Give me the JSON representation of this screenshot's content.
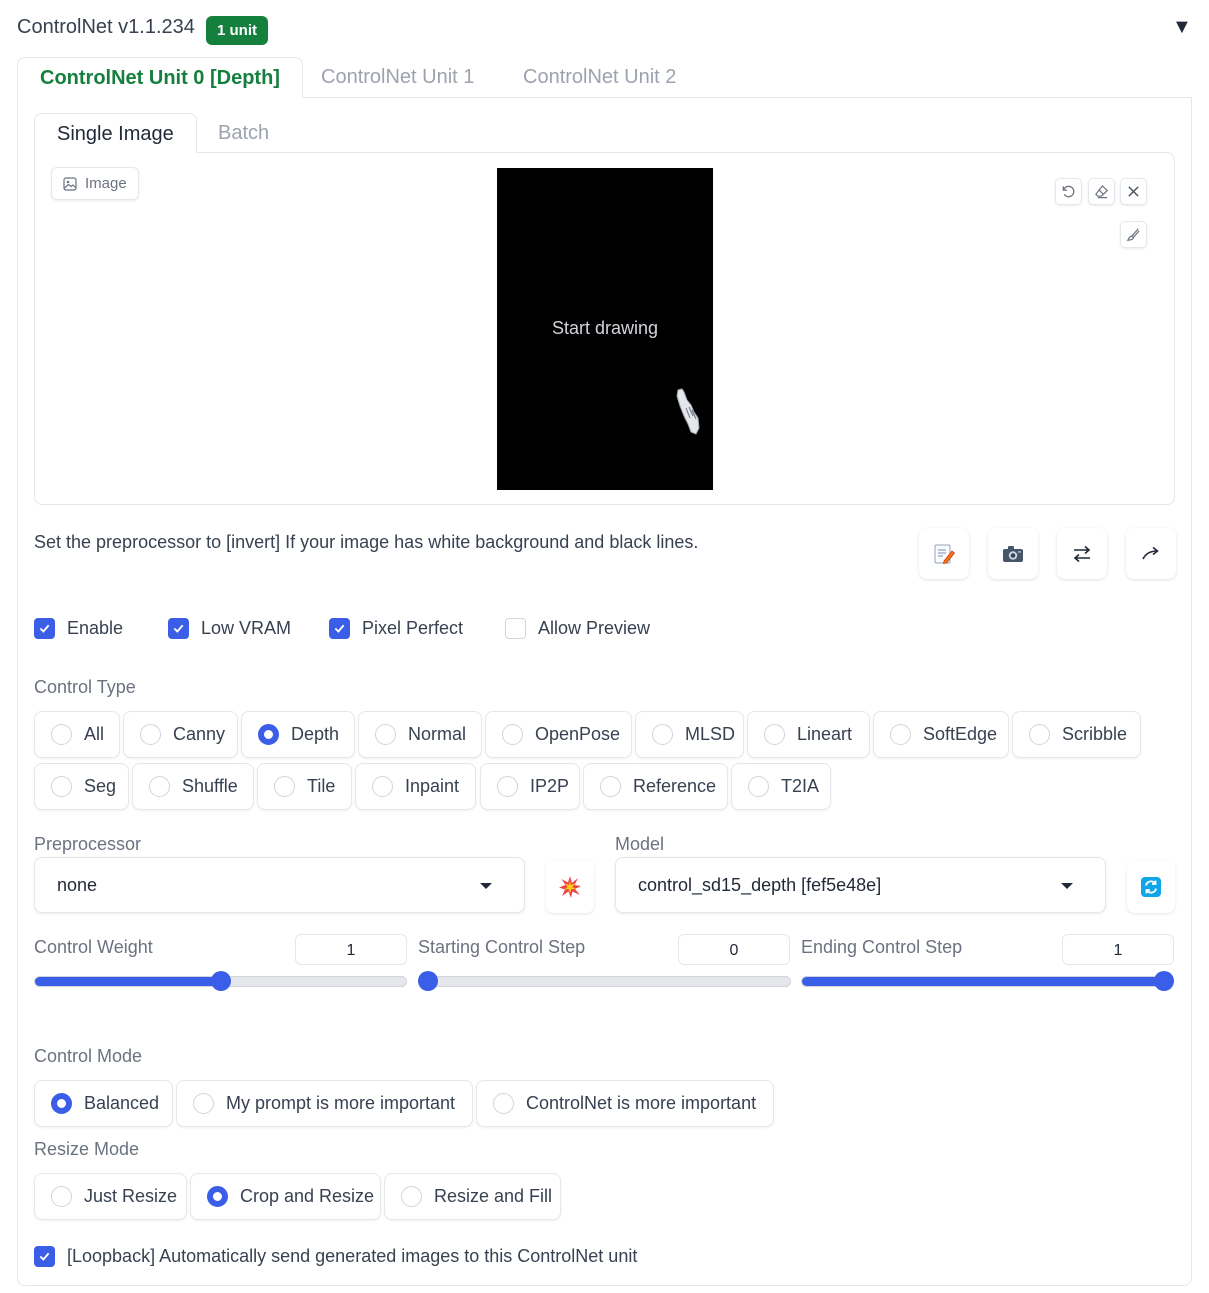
{
  "header": {
    "title": "ControlNet v1.1.234",
    "badge": "1 unit",
    "collapse_icon": "▼"
  },
  "unit_tabs": [
    {
      "label": "ControlNet Unit 0 [Depth]",
      "active": true
    },
    {
      "label": "ControlNet Unit 1",
      "active": false
    },
    {
      "label": "ControlNet Unit 2",
      "active": false
    }
  ],
  "image_tabs": [
    {
      "label": "Single Image",
      "active": true
    },
    {
      "label": "Batch",
      "active": false
    }
  ],
  "image_panel": {
    "label": "Image",
    "canvas_text": "Start drawing",
    "tools": [
      "undo-icon",
      "eraser-icon",
      "close-icon",
      "brush-icon"
    ]
  },
  "hint": "Set the preprocessor to [invert] If your image has white background and black lines.",
  "action_icons": [
    "memo-edit-icon",
    "camera-icon",
    "swap-icon",
    "send-arrow-icon"
  ],
  "checkboxes": [
    {
      "label": "Enable",
      "checked": true
    },
    {
      "label": "Low VRAM",
      "checked": true
    },
    {
      "label": "Pixel Perfect",
      "checked": true
    },
    {
      "label": "Allow Preview",
      "checked": false
    }
  ],
  "control_type": {
    "label": "Control Type",
    "selected": "Depth",
    "options": [
      "All",
      "Canny",
      "Depth",
      "Normal",
      "OpenPose",
      "MLSD",
      "Lineart",
      "SoftEdge",
      "Scribble",
      "Seg",
      "Shuffle",
      "Tile",
      "Inpaint",
      "IP2P",
      "Reference",
      "T2IA"
    ]
  },
  "preprocessor": {
    "label": "Preprocessor",
    "value": "none",
    "run_icon": "explosion-icon"
  },
  "model": {
    "label": "Model",
    "value": "control_sd15_depth [fef5e48e]",
    "refresh_icon": "refresh-icon"
  },
  "sliders": [
    {
      "label": "Control Weight",
      "value": "1",
      "min": 0,
      "max": 2,
      "num": 1
    },
    {
      "label": "Starting Control Step",
      "value": "0",
      "min": 0,
      "max": 1,
      "num": 0
    },
    {
      "label": "Ending Control Step",
      "value": "1",
      "min": 0,
      "max": 1,
      "num": 1
    }
  ],
  "control_mode": {
    "label": "Control Mode",
    "selected": "Balanced",
    "options": [
      "Balanced",
      "My prompt is more important",
      "ControlNet is more important"
    ]
  },
  "resize_mode": {
    "label": "Resize Mode",
    "selected": "Crop and Resize",
    "options": [
      "Just Resize",
      "Crop and Resize",
      "Resize and Fill"
    ]
  },
  "loopback": {
    "label": "[Loopback] Automatically send generated images to this ControlNet unit",
    "checked": true
  },
  "colors": {
    "accent": "#3b5ee8",
    "tab_active": "#15803d",
    "badge": "#15803d"
  }
}
